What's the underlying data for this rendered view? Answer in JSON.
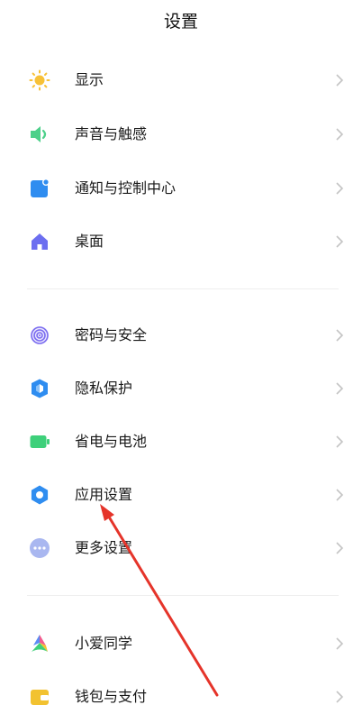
{
  "header": {
    "title": "设置"
  },
  "sections": [
    {
      "items": [
        {
          "label": "显示",
          "icon": "sun-icon",
          "color": "#F7C137"
        },
        {
          "label": "声音与触感",
          "icon": "speaker-icon",
          "color": "#4CD08A"
        },
        {
          "label": "通知与控制中心",
          "icon": "notification-icon",
          "color": "#2F8DF0"
        },
        {
          "label": "桌面",
          "icon": "home-icon",
          "color": "#6C6EF0"
        }
      ]
    },
    {
      "items": [
        {
          "label": "密码与安全",
          "icon": "fingerprint-icon",
          "color": "#7B6CF0"
        },
        {
          "label": "隐私保护",
          "icon": "privacy-shield-icon",
          "color": "#2F8DF0"
        },
        {
          "label": "省电与电池",
          "icon": "battery-icon",
          "color": "#3ED07A"
        },
        {
          "label": "应用设置",
          "icon": "gear-icon",
          "color": "#2F8DF0"
        },
        {
          "label": "更多设置",
          "icon": "more-dots-icon",
          "color": "#A9B7F0"
        }
      ]
    },
    {
      "items": [
        {
          "label": "小爱同学",
          "icon": "xiaoai-icon",
          "color": "#5B8CF5"
        },
        {
          "label": "钱包与支付",
          "icon": "wallet-icon",
          "color": "#F2C230"
        }
      ]
    }
  ],
  "annotation": {
    "arrow_color": "#E5342A"
  }
}
